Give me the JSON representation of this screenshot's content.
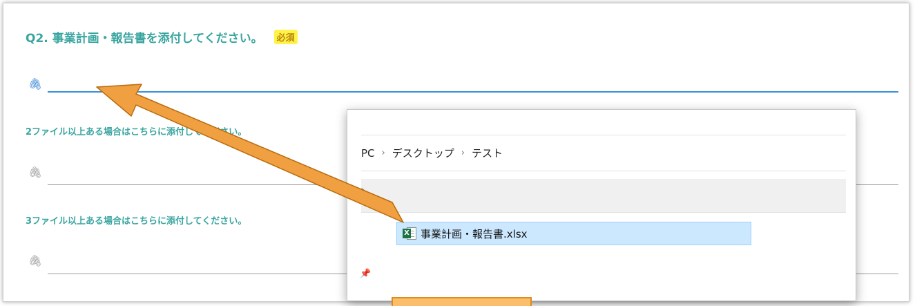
{
  "question": {
    "title": "Q2. 事業計画・報告書を添付してください。",
    "required_badge": "必須"
  },
  "fields": [
    {
      "label": "",
      "icon": "paperclip-icon"
    },
    {
      "label": "2ファイル以上ある場合はこちらに添付してください。",
      "icon": "paperclip-icon"
    },
    {
      "label": "3ファイル以上ある場合はこちらに添付してください。",
      "icon": "paperclip-icon"
    }
  ],
  "explorer": {
    "breadcrumb": [
      "PC",
      "デスクトップ",
      "テスト"
    ],
    "breadcrumb_sep": "›",
    "file_name": "事業計画・報告書.xlsx"
  },
  "colors": {
    "accent_teal": "#3aa5a0",
    "required_yellow": "#fff34a",
    "active_underline": "#3b8ed8",
    "arrow_orange": "#f0a040",
    "selection_blue": "#cce8ff"
  }
}
